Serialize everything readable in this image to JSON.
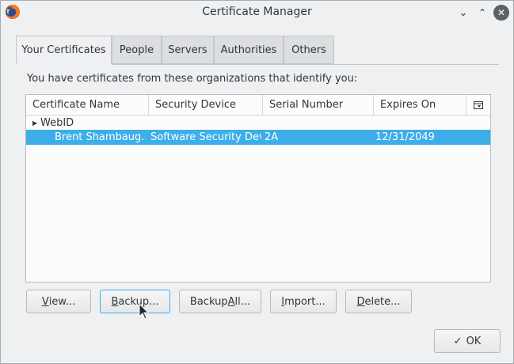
{
  "window": {
    "title": "Certificate Manager"
  },
  "tabs": [
    {
      "label": "Your Certificates",
      "active": true
    },
    {
      "label": "People"
    },
    {
      "label": "Servers"
    },
    {
      "label": "Authorities"
    },
    {
      "label": "Others"
    }
  ],
  "intro_text": "You have certificates from these organizations that identify you:",
  "table": {
    "columns": [
      "Certificate Name",
      "Security Device",
      "Serial Number",
      "Expires On"
    ],
    "groups": [
      {
        "name": "WebID",
        "rows": [
          {
            "name": "Brent Shambaug...",
            "device": "Software Security Dev...",
            "serial": "2A",
            "expires": "12/31/2049",
            "selected": true
          }
        ]
      }
    ]
  },
  "buttons": {
    "view": {
      "pre": "",
      "u": "V",
      "post": "iew..."
    },
    "backup": {
      "pre": "",
      "u": "B",
      "post": "ackup..."
    },
    "backup_all": {
      "pre": "Backup ",
      "u": "A",
      "post": "ll..."
    },
    "import": {
      "pre": "",
      "u": "I",
      "post": "mport..."
    },
    "delete": {
      "pre": "",
      "u": "D",
      "post": "elete..."
    },
    "ok": "OK"
  }
}
